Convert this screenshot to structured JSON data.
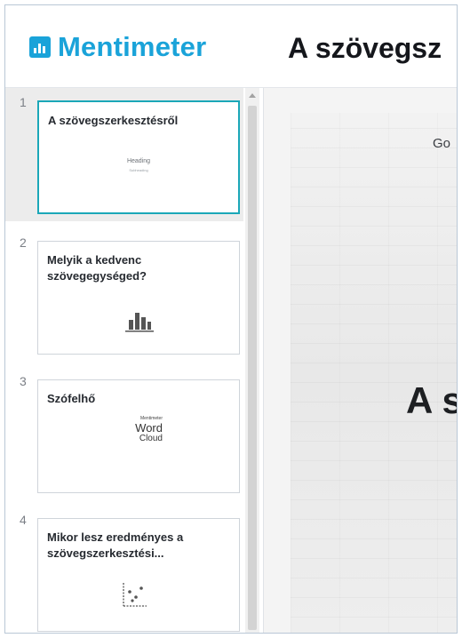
{
  "header": {
    "brand": "Mentimeter",
    "presentation_title": "A szövegsz"
  },
  "slides": [
    {
      "number": "1",
      "title": "A szövegszerkesztésről",
      "type": "heading",
      "preview_heading": "Heading",
      "preview_sub": "Subheading"
    },
    {
      "number": "2",
      "title": "Melyik a kedvenc szövegegységed?",
      "type": "bar-chart"
    },
    {
      "number": "3",
      "title": "Szófelhő",
      "type": "word-cloud",
      "preview_words": [
        "Mentimeter",
        "Word",
        "Cloud"
      ]
    },
    {
      "number": "4",
      "title": "Mikor lesz eredményes a szövegszerkesztési...",
      "type": "scatter"
    }
  ],
  "preview": {
    "top_text": "Go",
    "heading": "A s"
  },
  "colors": {
    "brand": "#1aa3d9",
    "active_border": "#1ba7b8"
  }
}
